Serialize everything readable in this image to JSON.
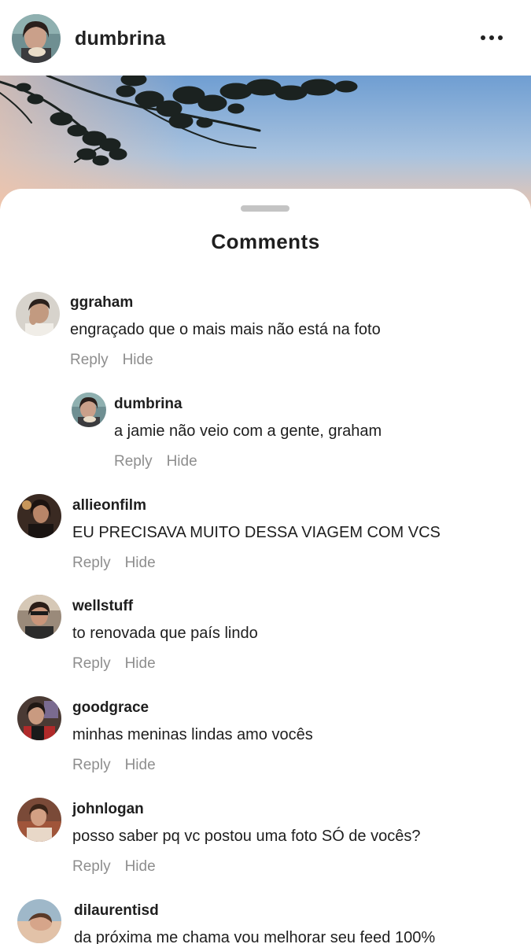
{
  "header": {
    "username": "dumbrina",
    "more_icon": "more-horizontal-icon"
  },
  "sheet": {
    "title": "Comments"
  },
  "actions": {
    "reply": "Reply",
    "hide": "Hide"
  },
  "comments": [
    {
      "user": "ggraham",
      "text": "engraçado que o mais mais não está na foto"
    },
    {
      "user": "dumbrina",
      "text": "a jamie não veio com a gente, graham"
    },
    {
      "user": "allieonfilm",
      "text": "EU PRECISAVA MUITO DESSA VIAGEM COM VCS"
    },
    {
      "user": "wellstuff",
      "text": "to renovada que país lindo"
    },
    {
      "user": "goodgrace",
      "text": "minhas meninas lindas amo vocês"
    },
    {
      "user": "johnlogan",
      "text": "posso saber pq vc postou uma foto SÓ de vocês?"
    },
    {
      "user": "dilaurentisd",
      "text": "da próxima me chama vou melhorar seu feed 100%"
    }
  ]
}
